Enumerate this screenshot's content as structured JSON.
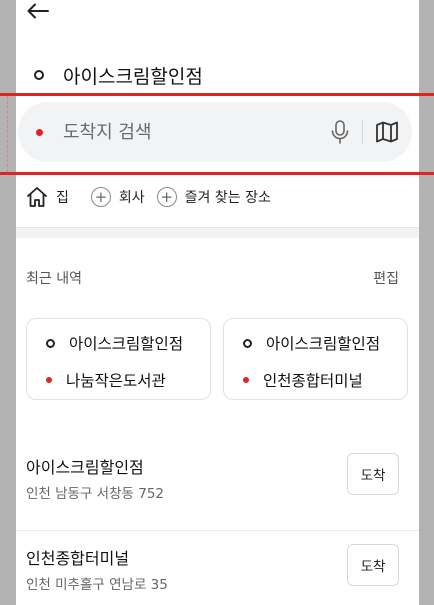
{
  "header": {
    "back_icon": "arrow-left-icon"
  },
  "search": {
    "origin": "아이스크림할인점",
    "destination_placeholder": "도착지 검색",
    "mic_icon": "microphone-icon",
    "map_icon": "map-icon"
  },
  "quick": {
    "home_label": "집",
    "company_label": "회사",
    "favorites_label": "즐겨 찾는 장소"
  },
  "recent": {
    "title": "최근 내역",
    "edit_label": "편집",
    "routes": [
      {
        "from": "아이스크림할인점",
        "to": "나눔작은도서관"
      },
      {
        "from": "아이스크림할인점",
        "to": "인천종합터미널"
      }
    ],
    "places": [
      {
        "name": "아이스크림할인점",
        "address": "인천 남동구 서창동 752",
        "action": "도착"
      },
      {
        "name": "인천종합터미널",
        "address": "인천 미추홀구 연남로 35",
        "action": "도착"
      }
    ]
  },
  "colors": {
    "highlight_red": "#e02424",
    "page_background": "#b3b3b3"
  }
}
